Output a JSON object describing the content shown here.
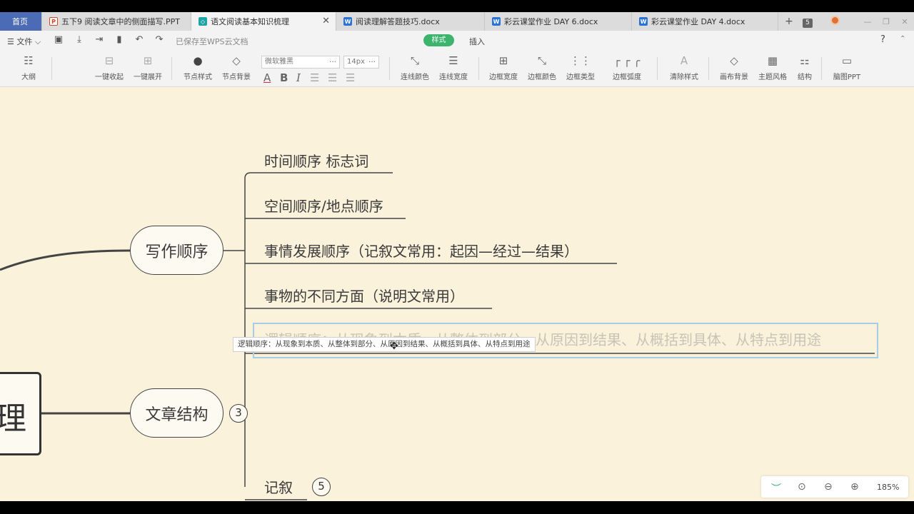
{
  "tabs": {
    "home": "首页",
    "items": [
      {
        "label": "五下9  阅读文章中的侧面描写.PPT",
        "icon": "ppt-icon",
        "active": false
      },
      {
        "label": "语文阅读基本知识梳理",
        "icon": "mindmap-icon",
        "active": true
      },
      {
        "label": "阅读理解答题技巧.docx",
        "icon": "word-icon",
        "active": false
      },
      {
        "label": "彩云课堂作业 DAY 6.docx",
        "icon": "word-icon",
        "active": false
      },
      {
        "label": "彩云课堂作业 DAY 4.docx",
        "icon": "word-icon",
        "active": false
      }
    ],
    "add": "+",
    "count": "5"
  },
  "menu": {
    "file": "文件",
    "saved_status": "已保存至WPS云文档",
    "style_tab": "样式",
    "insert_tab": "插入",
    "help": "?"
  },
  "toolbar": {
    "outline": "大纲",
    "collapse_all": "一键收起",
    "expand_all": "一键展开",
    "node_style": "节点样式",
    "node_bg": "节点背景",
    "font_name": "微软雅黑",
    "font_size": "14px",
    "bold": "B",
    "italic": "I",
    "line_color": "连线颜色",
    "line_width": "连线宽度",
    "border_width": "边框宽度",
    "border_color": "边框颜色",
    "border_type": "边框类型",
    "border_radius": "边框弧度",
    "clear_style": "清除样式",
    "canvas_bg": "画布背景",
    "theme": "主题风格",
    "structure": "结构",
    "to_ppt": "脑图PPT"
  },
  "mindmap": {
    "root_fragment": "理",
    "branches": [
      {
        "label": "写作顺序",
        "children": [
          "时间顺序  标志词",
          "空间顺序/地点顺序",
          "事情发展顺序（记叙文常用：起因—经过—结果）",
          "事物的不同方面（说明文常用）"
        ]
      },
      {
        "label": "文章结构",
        "count": "3"
      }
    ],
    "editing_text": "逻辑顺序：从现象到本质、从整体到部分、从原因到结果、从概括到具体、从特点到用途",
    "tooltip_text": "逻辑顺序：从现象到本质、从整体到部分、从原因到结果、从概括到具体、从特点到用途",
    "bottom_node": {
      "label": "记叙",
      "count": "5"
    }
  },
  "zoom": {
    "value": "185%"
  },
  "colors": {
    "canvas": "#fbf2dc",
    "accent": "#3cb46e",
    "home_tab": "#4b6bb7"
  }
}
